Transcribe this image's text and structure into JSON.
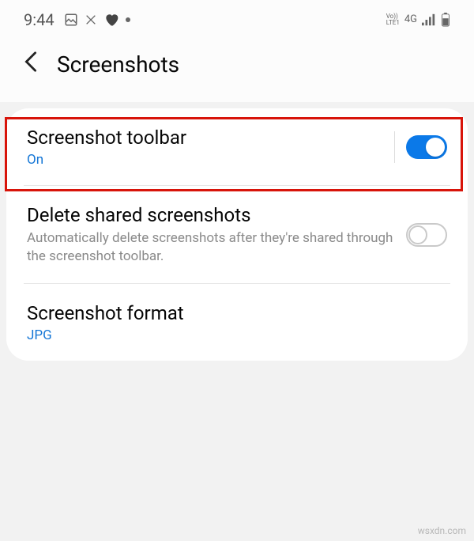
{
  "statusBar": {
    "time": "9:44",
    "networkLabel1": "Vo))",
    "networkLabel2": "LTE1",
    "networkType": "4G"
  },
  "header": {
    "title": "Screenshots"
  },
  "settings": {
    "toolbar": {
      "title": "Screenshot toolbar",
      "status": "On"
    },
    "deleteShared": {
      "title": "Delete shared screenshots",
      "description": "Automatically delete screenshots after they're shared through the screenshot toolbar."
    },
    "format": {
      "title": "Screenshot format",
      "value": "JPG"
    }
  },
  "watermark": "wsxdn.com"
}
